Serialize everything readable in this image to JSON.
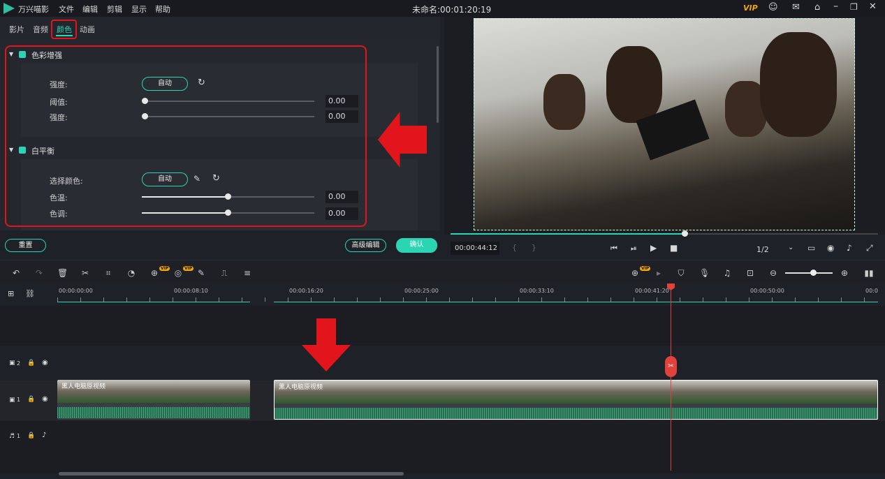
{
  "app": {
    "name": "万兴喵影",
    "title": "未命名:00:01:20:19",
    "vip": "VIP"
  },
  "menu": [
    "文件",
    "编辑",
    "剪辑",
    "显示",
    "帮助"
  ],
  "tabs": [
    "影片",
    "音频",
    "颜色",
    "动画"
  ],
  "color_enhance": {
    "title": "色彩增强",
    "strength_label": "强度:",
    "auto": "自动",
    "threshold_label": "阈值:",
    "threshold_value": "0.00",
    "strength2_label": "强度:",
    "strength2_value": "0.00"
  },
  "white_balance": {
    "title": "白平衡",
    "pick_label": "选择颜色:",
    "auto": "自动",
    "temp_label": "色温:",
    "temp_value": "0.00",
    "tint_label": "色调:",
    "tint_value": "0.00"
  },
  "buttons": {
    "reset": "重置",
    "advanced": "高级编辑",
    "ok": "确认"
  },
  "player": {
    "time": "00:00:44:12",
    "quality": "1/2",
    "progress": 0.53
  },
  "ruler": [
    "00:00:00:00",
    "00:00:08:10",
    "00:00:16:20",
    "00:00:25:00",
    "00:00:33:10",
    "00:00:41:20",
    "00:00:50:00",
    "00:0"
  ],
  "tracks": {
    "v2": "2",
    "v1": "1",
    "a1": "1"
  },
  "clips": {
    "clip1": "黑人电脑原视频",
    "clip2": "黑人电脑原视频"
  },
  "colors": {
    "accent": "#2bd4b2",
    "highlight": "#e3151c"
  }
}
